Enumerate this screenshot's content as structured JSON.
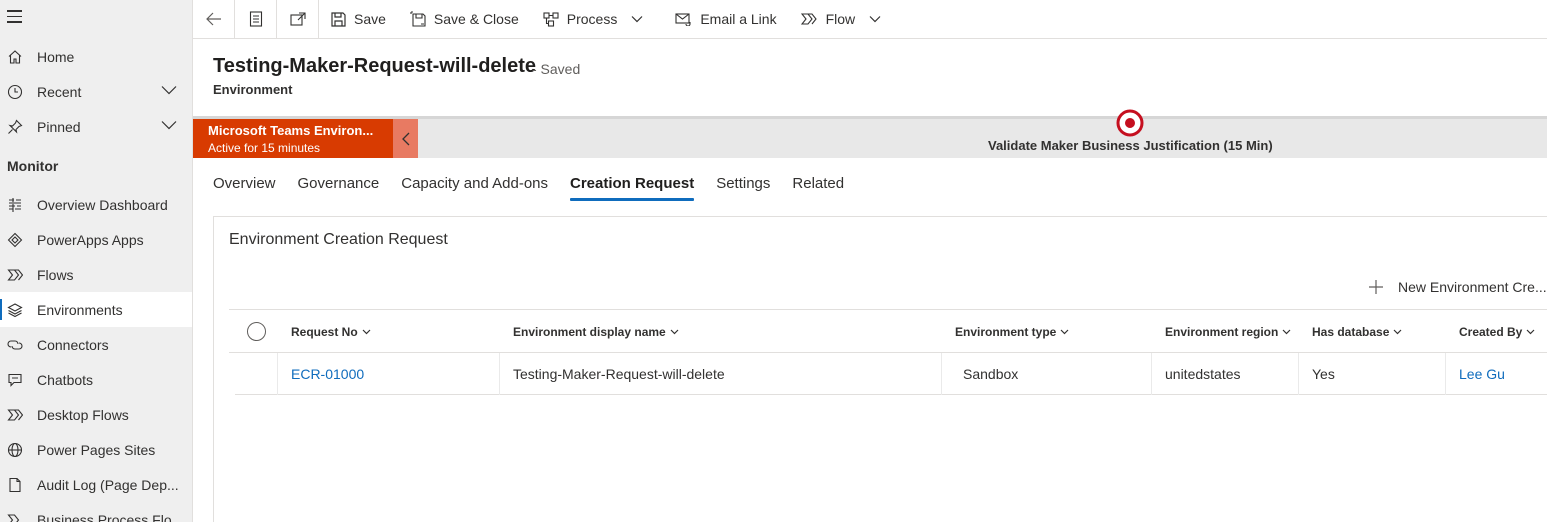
{
  "sidebar": {
    "items_top": [
      {
        "label": "Home",
        "icon": "home-icon"
      },
      {
        "label": "Recent",
        "icon": "clock-icon"
      },
      {
        "label": "Pinned",
        "icon": "pin-icon"
      }
    ],
    "section": "Monitor",
    "items": [
      {
        "label": "Overview Dashboard",
        "icon": "dashboard-icon"
      },
      {
        "label": "PowerApps Apps",
        "icon": "powerapps-icon"
      },
      {
        "label": "Flows",
        "icon": "flow-icon"
      },
      {
        "label": "Environments",
        "icon": "layers-icon"
      },
      {
        "label": "Connectors",
        "icon": "connector-icon"
      },
      {
        "label": "Chatbots",
        "icon": "chatbot-icon"
      },
      {
        "label": "Desktop Flows",
        "icon": "desktop-flow-icon"
      },
      {
        "label": "Power Pages Sites",
        "icon": "globe-icon"
      },
      {
        "label": "Audit Log (Page Dep...",
        "icon": "audit-icon"
      },
      {
        "label": "Business Process Flo...",
        "icon": "bpf-icon"
      }
    ]
  },
  "toolbar": {
    "save": "Save",
    "save_close": "Save & Close",
    "process": "Process",
    "email_link": "Email a Link",
    "flow": "Flow"
  },
  "record": {
    "title": "Testing-Maker-Request-will-delete",
    "status": "- Saved",
    "entity": "Environment"
  },
  "bpf": {
    "stage_name": "Microsoft Teams Environ...",
    "stage_sub": "Active for 15 minutes",
    "active_stage": "Validate Maker Business Justification",
    "active_duration": "(15 Min)"
  },
  "tabs": [
    "Overview",
    "Governance",
    "Capacity and Add-ons",
    "Creation Request",
    "Settings",
    "Related"
  ],
  "active_tab": "Creation Request",
  "card": {
    "title": "Environment Creation Request",
    "new_button": "New Environment Cre...",
    "columns": [
      "Request No",
      "Environment display name",
      "Environment type",
      "Environment region",
      "Has database",
      "Created By"
    ],
    "rows": [
      {
        "request_no": "ECR-01000",
        "display_name": "Testing-Maker-Request-will-delete",
        "type": "Sandbox",
        "region": "unitedstates",
        "has_database": "Yes",
        "created_by": "Lee Gu"
      }
    ]
  },
  "colors": {
    "accent": "#0f6cbd",
    "stage_active": "#d83b01",
    "target": "#c50f1f"
  }
}
